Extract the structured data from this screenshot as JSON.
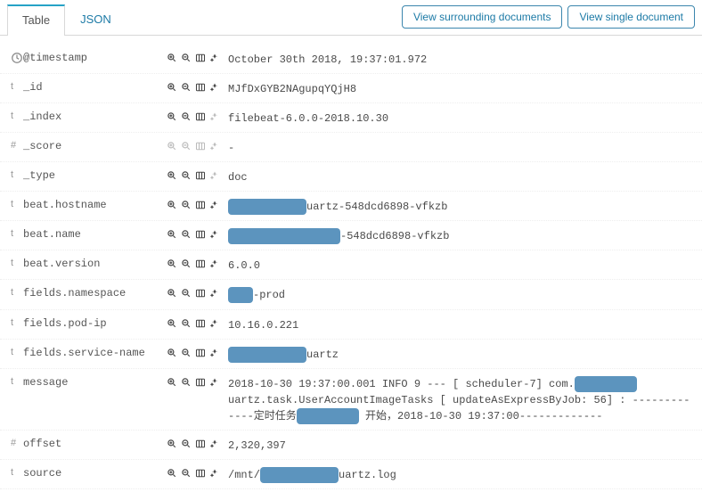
{
  "tabs": {
    "table": "Table",
    "json": "JSON"
  },
  "header_buttons": {
    "surrounding": "View surrounding documents",
    "single": "View single document"
  },
  "icons": {
    "clock": "clock-icon",
    "text": "t",
    "hash": "#",
    "zoom_in": "zoom-in-icon",
    "zoom_out": "zoom-out-icon",
    "columns": "columns-icon",
    "exists": "exists-filter-icon"
  },
  "fields": {
    "timestamp": {
      "name": "@timestamp",
      "type": "time",
      "value": "October 30th 2018, 19:37:01.972"
    },
    "id": {
      "name": "_id",
      "type": "t",
      "value": "MJfDxGYB2NAgupqYQjH8"
    },
    "index": {
      "name": "_index",
      "type": "t",
      "value": "filebeat-6.0.0-2018.10.30"
    },
    "score": {
      "name": "_score",
      "type": "#",
      "value": " -"
    },
    "doctype": {
      "name": "_type",
      "type": "t",
      "value": "doc"
    },
    "beat_hostname": {
      "name": "beat.hostname",
      "type": "t",
      "value_suffix": "uartz-548dcd6898-vfkzb"
    },
    "beat_name": {
      "name": "beat.name",
      "type": "t",
      "value_suffix": "-548dcd6898-vfkzb"
    },
    "beat_version": {
      "name": "beat.version",
      "type": "t",
      "value": "6.0.0"
    },
    "fields_namespace": {
      "name": "fields.namespace",
      "type": "t",
      "value_suffix": "-prod"
    },
    "fields_pod_ip": {
      "name": "fields.pod-ip",
      "type": "t",
      "value": "10.16.0.221"
    },
    "fields_service_name": {
      "name": "fields.service-name",
      "type": "t",
      "value_suffix": "uartz"
    },
    "message": {
      "name": "message",
      "type": "t",
      "line1_a": "2018-10-30 19:37:00.001  INFO 9 --- [    scheduler-7] com.",
      "line1_b": "uartz.task.UserAccountImageTasks",
      "line2_a": "[        updateAsExpressByJob:   56] : -------------定时任务",
      "line2_b": " 开始，2018-10-30 19:37:00-------------"
    },
    "offset": {
      "name": "offset",
      "type": "#",
      "value": "2,320,397"
    },
    "source": {
      "name": "source",
      "type": "t",
      "value_prefix": "/mnt/",
      "value_suffix": "uartz.log"
    }
  }
}
